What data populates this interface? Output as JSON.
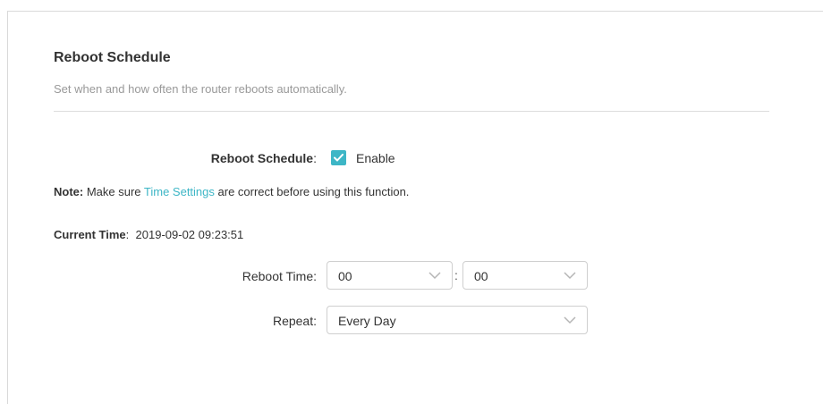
{
  "section": {
    "title": "Reboot Schedule",
    "description": "Set when and how often the router reboots automatically."
  },
  "schedule": {
    "label": "Reboot Schedule",
    "colon": ":",
    "checked": true,
    "enable_label": "Enable"
  },
  "note": {
    "prefix": "Note:",
    "text_before": " Make sure ",
    "link": "Time Settings",
    "text_after": " are correct before using this function."
  },
  "current_time": {
    "label": "Current Time",
    "colon": ":",
    "value": "2019-09-02 09:23:51"
  },
  "reboot_time": {
    "label": "Reboot Time:",
    "hour": "00",
    "separator": ":",
    "minute": "00"
  },
  "repeat": {
    "label": "Repeat:",
    "value": "Every Day"
  },
  "colors": {
    "accent": "#3db6c6",
    "muted_text": "#999999"
  },
  "icons": {
    "checkbox": "check-icon",
    "dropdown": "chevron-down-icon"
  }
}
